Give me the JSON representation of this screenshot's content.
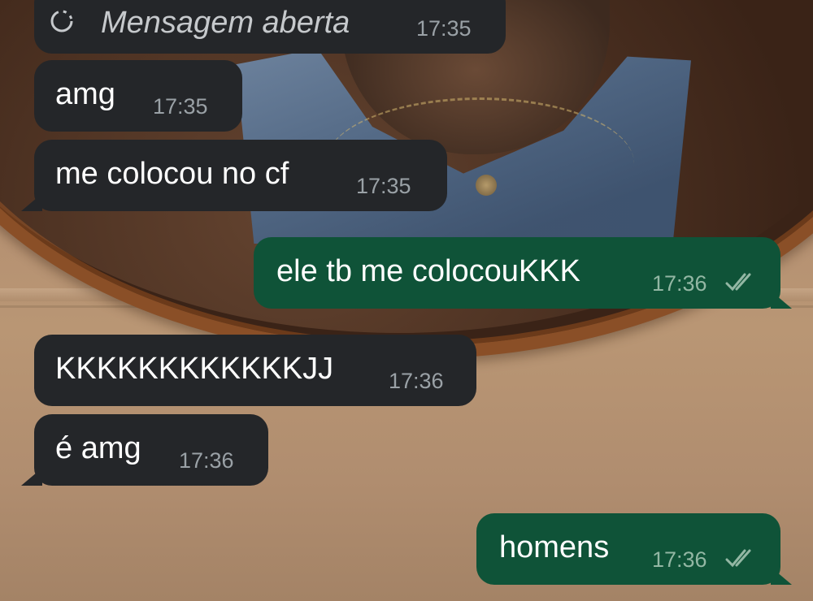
{
  "chat": {
    "messages": [
      {
        "direction": "incoming",
        "kind": "view-once",
        "text": "Mensagem aberta",
        "time": "17:35"
      },
      {
        "direction": "incoming",
        "text": "amg",
        "time": "17:35"
      },
      {
        "direction": "incoming",
        "text": "me colocou no cf",
        "time": "17:35"
      },
      {
        "direction": "outgoing",
        "text": "ele tb me colocouKKK",
        "time": "17:36",
        "status": "read"
      },
      {
        "direction": "incoming",
        "text": "KKKKKKKKKKKKJJ",
        "time": "17:36"
      },
      {
        "direction": "incoming",
        "text": "é amg",
        "time": "17:36"
      },
      {
        "direction": "outgoing",
        "text": "homens",
        "time": "17:36",
        "status": "read"
      }
    ]
  },
  "icons": {
    "view_once": "dashed-circle-icon",
    "read_receipt": "double-check-icon"
  },
  "colors": {
    "incoming_bubble": "#242629",
    "outgoing_bubble": "#0f5338",
    "timestamp": "#9aa1a6"
  }
}
